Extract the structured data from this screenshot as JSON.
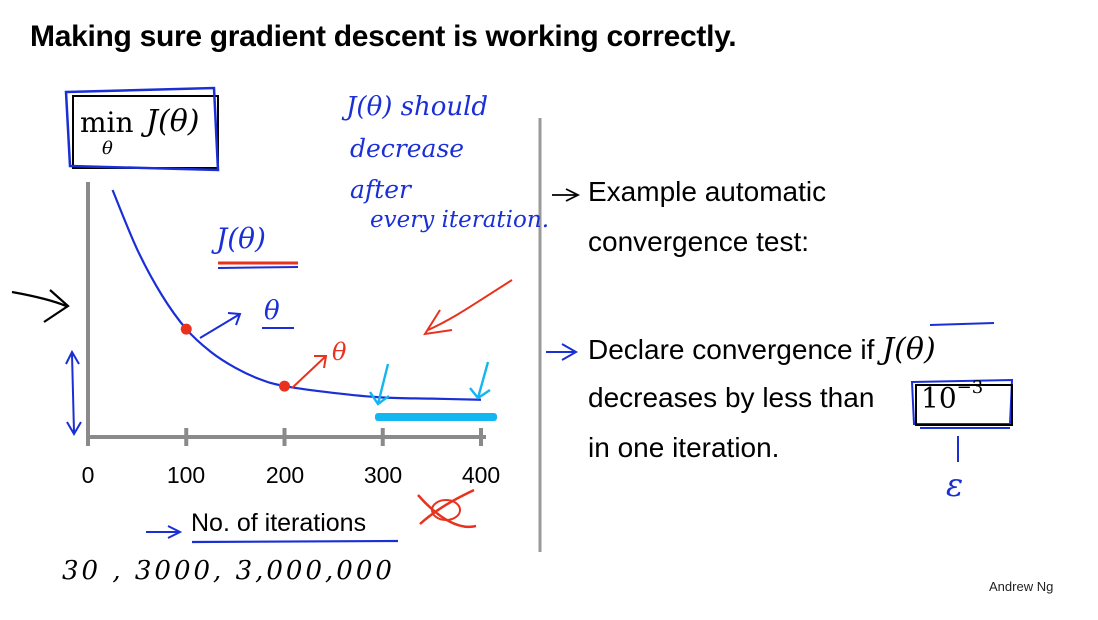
{
  "slide": {
    "title": "Making sure gradient descent is working correctly.",
    "credit": "Andrew Ng"
  },
  "objective": {
    "min": "min",
    "subscript": "θ",
    "function": "J(θ)"
  },
  "chart_data": {
    "type": "line",
    "x_ticks": [
      "0",
      "100",
      "200",
      "300",
      "400"
    ],
    "xlabel": "No. of iterations",
    "ylabel": "",
    "title": "",
    "xlim": [
      0,
      400
    ],
    "series": [
      {
        "x": [
          25,
          50,
          75,
          100,
          125,
          150,
          175,
          200,
          250,
          300,
          350,
          400
        ],
        "y": [
          1.0,
          0.74,
          0.54,
          0.39,
          0.29,
          0.22,
          0.17,
          0.14,
          0.11,
          0.09,
          0.085,
          0.08
        ]
      }
    ],
    "highlighted_points": [
      {
        "x": 100,
        "y": 0.39
      },
      {
        "x": 200,
        "y": 0.14
      }
    ],
    "converged_range": [
      300,
      400
    ]
  },
  "bullets": [
    {
      "lines": [
        "Example automatic",
        "convergence test:"
      ]
    },
    {
      "line1_prefix": "Declare convergence if ",
      "line1_math": "J(θ)",
      "line2_prefix": "decreases by less than ",
      "line2_base": "10",
      "line2_exp": "−3",
      "line3": "in one iteration."
    }
  ],
  "annotations": {
    "note_lines": [
      "J(θ) should",
      "decrease",
      "after",
      "every iteration."
    ],
    "curve_label": "J(θ)",
    "theta_mark_1": "θ",
    "theta_mark_2": "θ",
    "iteration_counts": "30 ,   3000,  3,000,000",
    "epsilon": "ε"
  },
  "colors": {
    "ink_blue": "#1a2fd6",
    "ink_red": "#e8321e",
    "highlight_cyan": "#12b6f0",
    "axis_gray": "#8a8a8a",
    "divider_gray": "#9a9a9a"
  }
}
